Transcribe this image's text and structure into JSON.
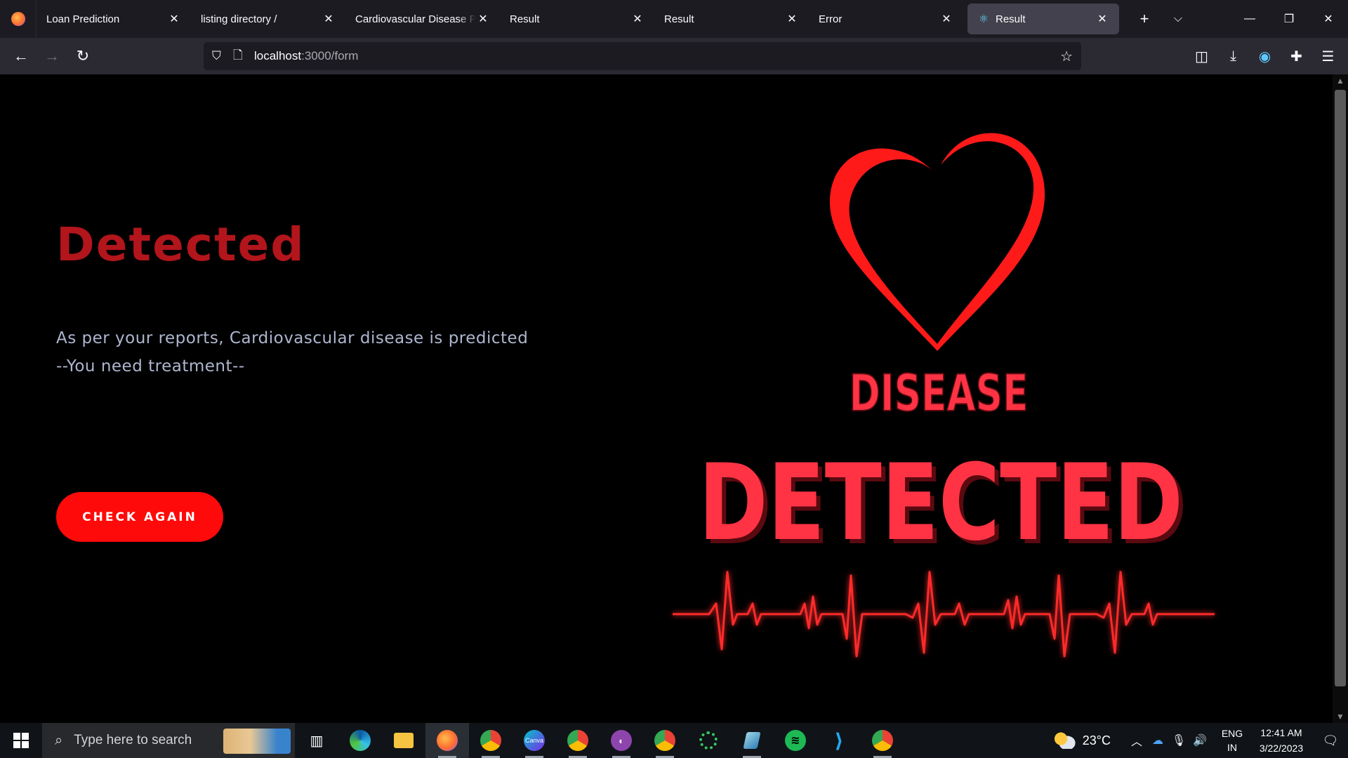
{
  "browser": {
    "tabs": [
      {
        "title": "Loan Prediction"
      },
      {
        "title": "listing directory /"
      },
      {
        "title": "Cardiovascular Disease Prediction"
      },
      {
        "title": "Result"
      },
      {
        "title": "Result"
      },
      {
        "title": "Error"
      },
      {
        "title": "Result",
        "active": true
      }
    ],
    "url_host": "localhost",
    "url_path": ":3000/form"
  },
  "main": {
    "headline": "Detected",
    "message_line1": "As per your reports, Cardiovascular disease is predicted",
    "message_line2": "--You need treatment--",
    "button_label": "CHECK AGAIN"
  },
  "illustration": {
    "word_top": "DISEASE",
    "word_bottom": "DETECTED",
    "colors": {
      "heart": "#ff1a1a",
      "text": "#ff3344",
      "shadow": "#5a0a10",
      "pulse": "#ff2a2a"
    }
  },
  "taskbar": {
    "search_placeholder": "Type here to search",
    "temperature": "23°C",
    "lang_line1": "ENG",
    "lang_line2": "IN",
    "time": "12:41 AM",
    "date": "3/22/2023",
    "apps": [
      "task-view",
      "edge",
      "file-explorer",
      "firefox",
      "chrome-profile-a",
      "canva",
      "chrome-profile-i",
      "github-desktop",
      "chrome-profile-s",
      "loader-app",
      "notes-app",
      "spotify",
      "vscode",
      "chrome"
    ]
  },
  "theme": {
    "accent": "#ff0a0a",
    "headline": "#b2151b",
    "body_text": "#aeb6cf"
  }
}
